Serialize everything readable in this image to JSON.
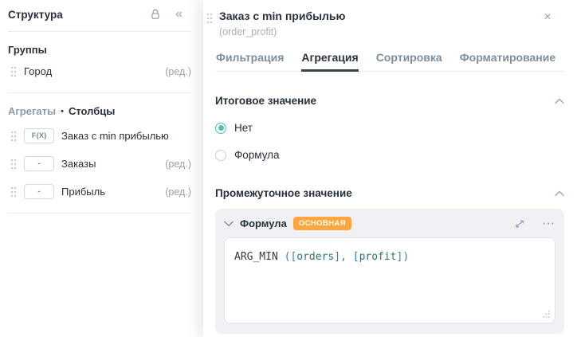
{
  "colors": {
    "accent_teal": "#4abfbf",
    "badge_orange": "#ffa63d",
    "text_dark": "#28313b",
    "text_gray": "#99a1ab",
    "icon_gray": "#9aa3b5",
    "tab_inactive": "#7e8e9d",
    "active_tab_underline": "#3b434d",
    "card_background": "#eff1f5",
    "code_punct_blue": "#3d7ac2",
    "code_field_teal": "#2e7474"
  },
  "left_panel": {
    "title": "Структура",
    "icons": {
      "collapse": "«"
    },
    "groups": {
      "title": "Группы",
      "items": [
        {
          "label": "Город",
          "edit": "(ред.)"
        }
      ]
    },
    "aggregates": {
      "breadcrumb": {
        "parent": "Агрегаты",
        "separator": "•",
        "current": "Столбцы"
      },
      "items": [
        {
          "badge": "F(X)",
          "label": "Заказ с min прибылью"
        },
        {
          "badge": "-",
          "label": "Заказы",
          "edit": "(ред.)"
        },
        {
          "badge": "-",
          "label": "Прибыль",
          "edit": "(ред.)"
        }
      ]
    }
  },
  "dialog": {
    "title": "Заказ с min прибылью",
    "subtitle": "(order_profit)",
    "close_icon": "✕",
    "tabs": [
      {
        "label": "Фильтрация",
        "active": false
      },
      {
        "label": "Агрегация",
        "active": true
      },
      {
        "label": "Сортировка",
        "active": false
      },
      {
        "label": "Форматирование",
        "active": false
      }
    ],
    "total_value": {
      "title": "Итоговое значение",
      "options": [
        {
          "label": "Нет",
          "selected": true
        },
        {
          "label": "Формула",
          "selected": false
        }
      ]
    },
    "intermediate_value": {
      "title": "Промежуточное значение",
      "formula_card": {
        "title": "Формула",
        "badge": "ОСНОВНАЯ",
        "ellipsis_icon": "···",
        "code_tokens": [
          {
            "text": "ARG_MIN ",
            "type": "function"
          },
          {
            "text": "([",
            "type": "punct"
          },
          {
            "text": "orders",
            "type": "field"
          },
          {
            "text": "], [",
            "type": "punct"
          },
          {
            "text": "profit",
            "type": "field"
          },
          {
            "text": "])",
            "type": "punct"
          }
        ]
      }
    }
  }
}
